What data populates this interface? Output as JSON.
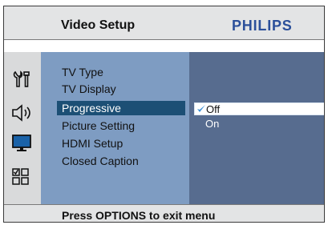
{
  "header": {
    "title": "Video Setup",
    "brand": "PHILIPS"
  },
  "sidebar": {
    "icons": [
      "general-setup-icon",
      "audio-setup-icon",
      "video-setup-icon",
      "preference-setup-icon"
    ]
  },
  "menu": {
    "items": [
      {
        "label": "TV Type"
      },
      {
        "label": "TV Display"
      },
      {
        "label": "Progressive"
      },
      {
        "label": "Picture Setting"
      },
      {
        "label": "HDMI Setup"
      },
      {
        "label": "Closed Caption"
      }
    ],
    "selected_index": 2
  },
  "options": {
    "items": [
      {
        "label": "Off"
      },
      {
        "label": "On"
      }
    ],
    "selected_index": 0
  },
  "footer": {
    "hint": "Press OPTIONS to exit menu"
  },
  "colors": {
    "header_bg": "#e3e4e5",
    "brand": "#2b4f9a",
    "menu_panel": "#7e9cc2",
    "options_panel": "#576c8f",
    "highlight": "#1c4f75",
    "check": "#3a8fd6"
  }
}
